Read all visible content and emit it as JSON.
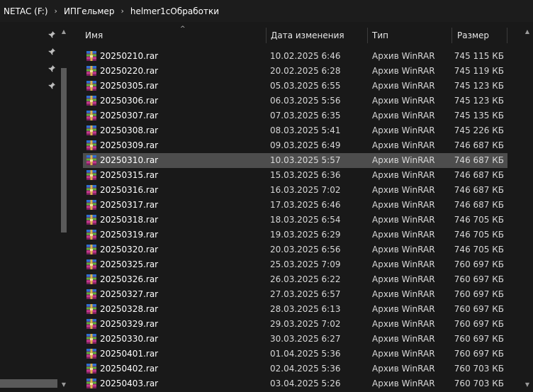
{
  "breadcrumb": {
    "items": [
      "NETAC (F:)",
      "ИПГельмер",
      "helmer1cОбработки"
    ],
    "separator": "›"
  },
  "columns": {
    "name": "Имя",
    "date": "Дата изменения",
    "type": "Тип",
    "size": "Размер"
  },
  "files": [
    {
      "name": "20250210.rar",
      "date": "10.02.2025 6:46",
      "type": "Архив WinRAR",
      "size": "745 115 КБ"
    },
    {
      "name": "20250220.rar",
      "date": "20.02.2025 6:28",
      "type": "Архив WinRAR",
      "size": "745 119 КБ"
    },
    {
      "name": "20250305.rar",
      "date": "05.03.2025 6:55",
      "type": "Архив WinRAR",
      "size": "745 123 КБ"
    },
    {
      "name": "20250306.rar",
      "date": "06.03.2025 5:56",
      "type": "Архив WinRAR",
      "size": "745 123 КБ"
    },
    {
      "name": "20250307.rar",
      "date": "07.03.2025 6:35",
      "type": "Архив WinRAR",
      "size": "745 135 КБ"
    },
    {
      "name": "20250308.rar",
      "date": "08.03.2025 5:41",
      "type": "Архив WinRAR",
      "size": "745 226 КБ"
    },
    {
      "name": "20250309.rar",
      "date": "09.03.2025 6:49",
      "type": "Архив WinRAR",
      "size": "746 687 КБ"
    },
    {
      "name": "20250310.rar",
      "date": "10.03.2025 5:57",
      "type": "Архив WinRAR",
      "size": "746 687 КБ",
      "selected": true
    },
    {
      "name": "20250315.rar",
      "date": "15.03.2025 6:36",
      "type": "Архив WinRAR",
      "size": "746 687 КБ"
    },
    {
      "name": "20250316.rar",
      "date": "16.03.2025 7:02",
      "type": "Архив WinRAR",
      "size": "746 687 КБ"
    },
    {
      "name": "20250317.rar",
      "date": "17.03.2025 6:46",
      "type": "Архив WinRAR",
      "size": "746 687 КБ"
    },
    {
      "name": "20250318.rar",
      "date": "18.03.2025 6:54",
      "type": "Архив WinRAR",
      "size": "746 705 КБ"
    },
    {
      "name": "20250319.rar",
      "date": "19.03.2025 6:29",
      "type": "Архив WinRAR",
      "size": "746 705 КБ"
    },
    {
      "name": "20250320.rar",
      "date": "20.03.2025 6:56",
      "type": "Архив WinRAR",
      "size": "746 705 КБ"
    },
    {
      "name": "20250325.rar",
      "date": "25.03.2025 7:09",
      "type": "Архив WinRAR",
      "size": "760 697 КБ"
    },
    {
      "name": "20250326.rar",
      "date": "26.03.2025 6:22",
      "type": "Архив WinRAR",
      "size": "760 697 КБ"
    },
    {
      "name": "20250327.rar",
      "date": "27.03.2025 6:57",
      "type": "Архив WinRAR",
      "size": "760 697 КБ"
    },
    {
      "name": "20250328.rar",
      "date": "28.03.2025 6:13",
      "type": "Архив WinRAR",
      "size": "760 697 КБ"
    },
    {
      "name": "20250329.rar",
      "date": "29.03.2025 7:02",
      "type": "Архив WinRAR",
      "size": "760 697 КБ"
    },
    {
      "name": "20250330.rar",
      "date": "30.03.2025 6:27",
      "type": "Архив WinRAR",
      "size": "760 697 КБ"
    },
    {
      "name": "20250401.rar",
      "date": "01.04.2025 5:36",
      "type": "Архив WinRAR",
      "size": "760 697 КБ"
    },
    {
      "name": "20250402.rar",
      "date": "02.04.2025 5:36",
      "type": "Архив WinRAR",
      "size": "760 703 КБ"
    },
    {
      "name": "20250403.rar",
      "date": "03.04.2025 5:26",
      "type": "Архив WinRAR",
      "size": "760 703 КБ"
    }
  ],
  "icons": {
    "file": "winrar-archive-icon",
    "pin": "pin-icon"
  },
  "colors": {
    "background": "#191919",
    "selected_row": "#4d4d4d"
  }
}
